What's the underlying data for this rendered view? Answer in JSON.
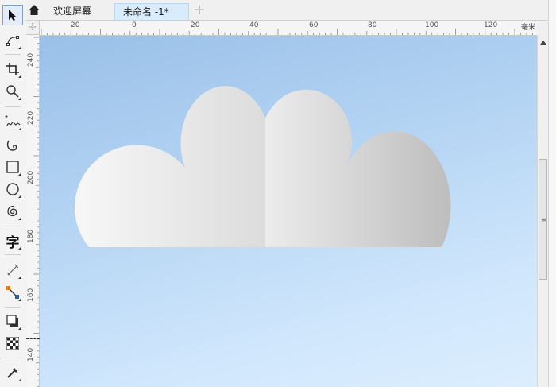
{
  "toolbox": {
    "tools": [
      {
        "id": "pick",
        "icon": "pointer-arrow-icon"
      },
      {
        "id": "shape",
        "icon": "shape-node-icon"
      },
      {
        "id": "crop",
        "icon": "crop-icon"
      },
      {
        "id": "zoom",
        "icon": "magnifier-icon"
      },
      {
        "id": "freehand",
        "icon": "freehand-icon"
      },
      {
        "id": "smart-draw",
        "icon": "spiral-curve-icon"
      },
      {
        "id": "rectangle",
        "icon": "rectangle-icon"
      },
      {
        "id": "ellipse",
        "icon": "ellipse-icon"
      },
      {
        "id": "polygon",
        "icon": "spiral-icon"
      },
      {
        "id": "text",
        "icon": "text-icon",
        "label": "字"
      },
      {
        "id": "dimension",
        "icon": "parallel-dimension-icon"
      },
      {
        "id": "connector",
        "icon": "connector-icon"
      },
      {
        "id": "drop-shadow",
        "icon": "drop-shadow-icon"
      },
      {
        "id": "transparency",
        "icon": "transparency-checker-icon"
      },
      {
        "id": "eyedropper",
        "icon": "eyedropper-icon"
      }
    ]
  },
  "tabs": {
    "home_icon": "home-icon",
    "items": [
      {
        "label": "欢迎屏幕",
        "active": false
      },
      {
        "label": "未命名 -1*",
        "active": true
      }
    ],
    "add_label": "+"
  },
  "hruler": {
    "labels": [
      "20",
      "0",
      "20",
      "40",
      "60",
      "80",
      "100",
      "120"
    ],
    "unit": "毫米"
  },
  "vruler": {
    "labels": [
      "240",
      "220",
      "200",
      "180",
      "160",
      "140"
    ]
  },
  "canvas": {
    "background_top": "#9ac0e8",
    "background_bottom": "#dceefe",
    "shape": "cloud"
  },
  "scrollbar": {
    "grip": "≡"
  }
}
